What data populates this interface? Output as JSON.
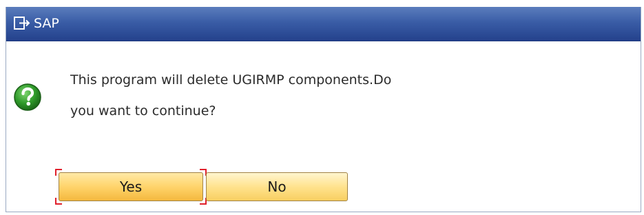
{
  "window": {
    "title": "SAP",
    "title_icon": "exit-door-icon"
  },
  "dialog": {
    "icon": "question-icon",
    "message_lines": [
      "This program will delete UGIRMP components.Do",
      "you want to continue?"
    ]
  },
  "buttons": {
    "yes_label": "Yes",
    "no_label": "No",
    "focused": "yes"
  },
  "colors": {
    "titlebar": "#3a5da6",
    "button": "#ffe38e",
    "focus_marker": "#e0202c",
    "question_icon": "#2f9a2a"
  }
}
